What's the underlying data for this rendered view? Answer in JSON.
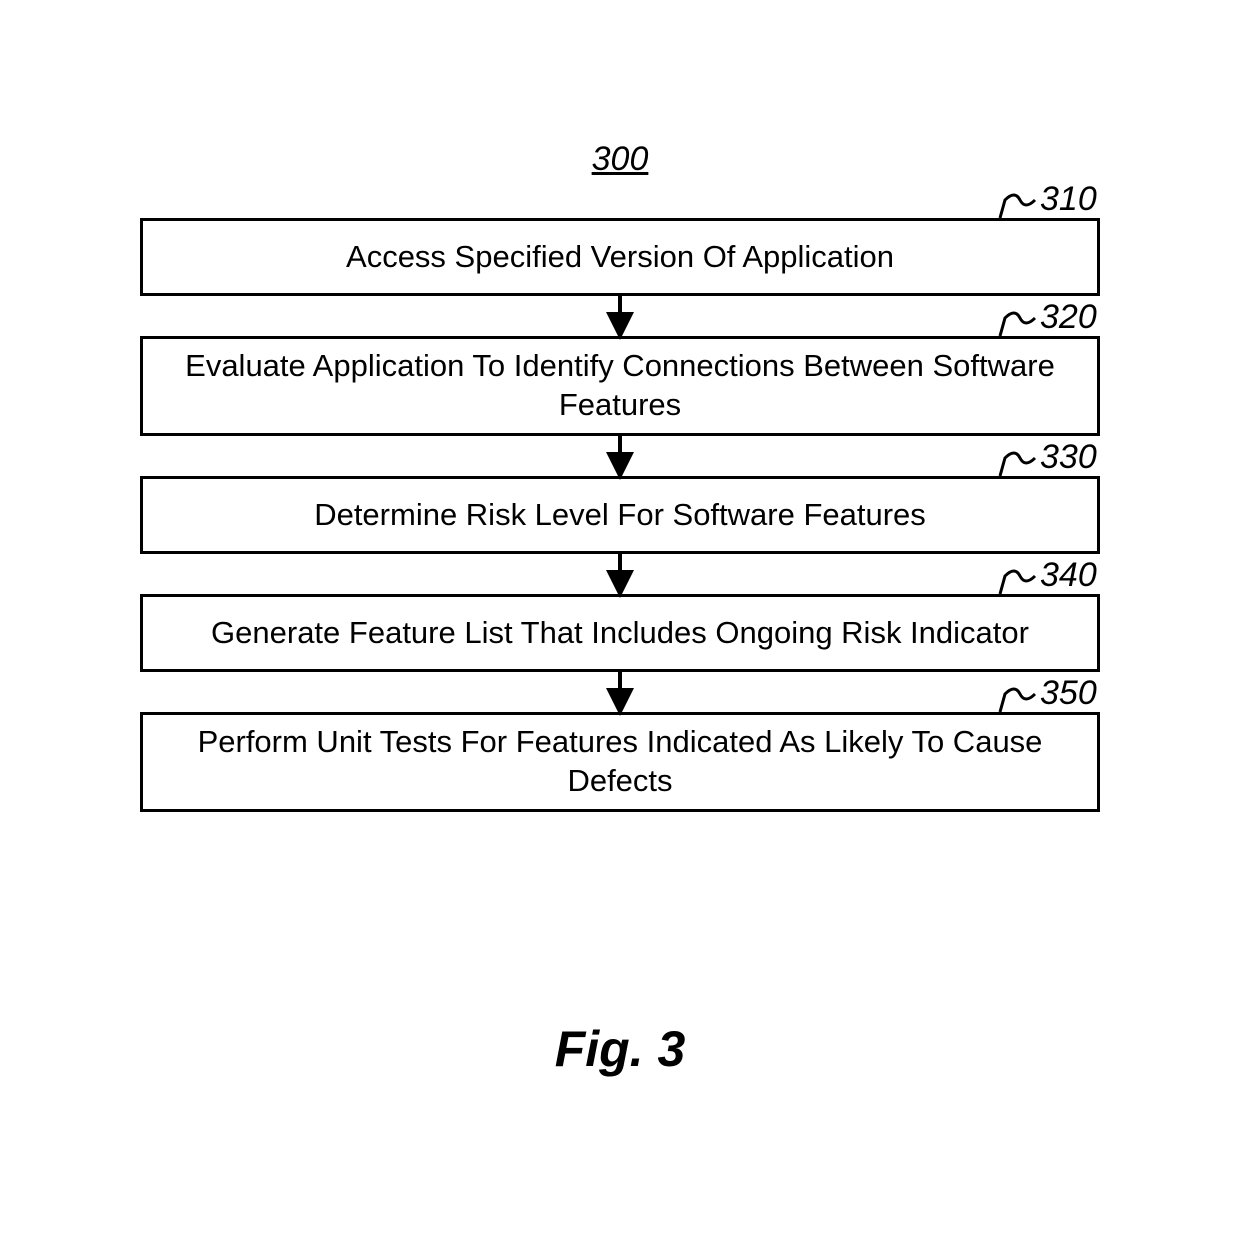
{
  "figure": {
    "number_label": "300",
    "caption": "Fig. 3"
  },
  "steps": [
    {
      "ref": "310",
      "text": "Access Specified Version Of Application"
    },
    {
      "ref": "320",
      "text": "Evaluate Application To Identify Connections Between Software Features"
    },
    {
      "ref": "330",
      "text": "Determine Risk Level For Software Features"
    },
    {
      "ref": "340",
      "text": "Generate Feature List That Includes Ongoing Risk Indicator"
    },
    {
      "ref": "350",
      "text": "Perform Unit Tests For Features Indicated As Likely To Cause Defects"
    }
  ],
  "chart_data": {
    "type": "flowchart",
    "title": "300",
    "nodes": [
      {
        "id": "310",
        "label": "Access Specified Version Of Application"
      },
      {
        "id": "320",
        "label": "Evaluate Application To Identify Connections Between Software Features"
      },
      {
        "id": "330",
        "label": "Determine Risk Level For Software Features"
      },
      {
        "id": "340",
        "label": "Generate Feature List That Includes Ongoing Risk Indicator"
      },
      {
        "id": "350",
        "label": "Perform Unit Tests For Features Indicated As Likely To Cause Defects"
      }
    ],
    "edges": [
      {
        "from": "310",
        "to": "320"
      },
      {
        "from": "320",
        "to": "330"
      },
      {
        "from": "330",
        "to": "340"
      },
      {
        "from": "340",
        "to": "350"
      }
    ]
  }
}
